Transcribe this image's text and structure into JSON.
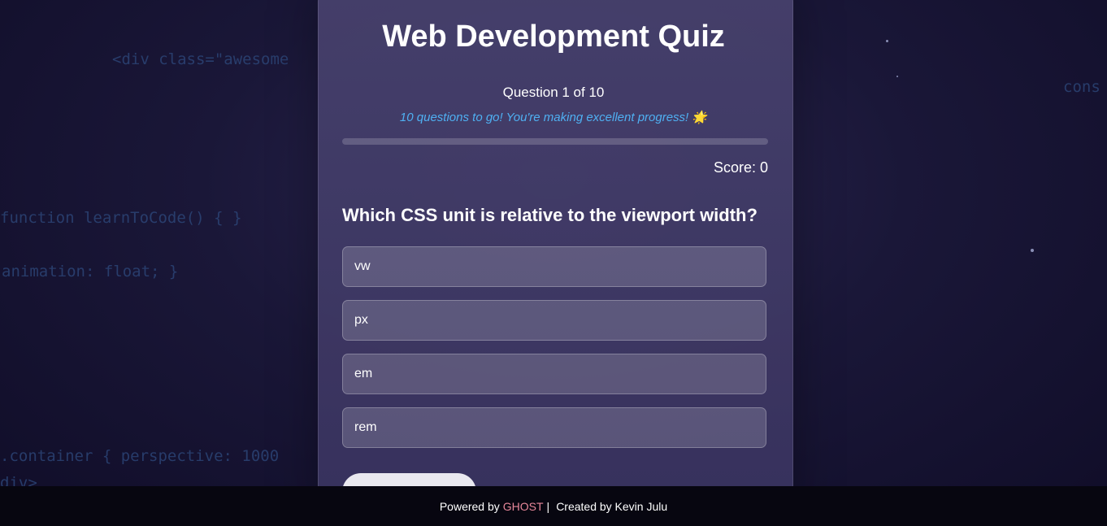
{
  "background_code": [
    "<div class=\"awesome",
    "function learnToCode() { }",
    "animation: float; }",
    ".container { perspective: 1000",
    "div>",
    "cons"
  ],
  "quiz": {
    "title": "Web Development Quiz",
    "question_counter": "Question 1 of 10",
    "motivation": "10 questions to go! You're making excellent progress! 🌟",
    "progress_fraction": 0,
    "score_label": "Score: 0",
    "question": "Which CSS unit is relative to the viewport width?",
    "options": [
      "vw",
      "px",
      "em",
      "rem"
    ]
  },
  "footer": {
    "powered_by": "Powered by",
    "brand": "GHOST",
    "separator": "|",
    "creator": "Created by Kevin Julu"
  },
  "colors": {
    "accent": "#4fb0f2",
    "brand": "#e7879a"
  }
}
